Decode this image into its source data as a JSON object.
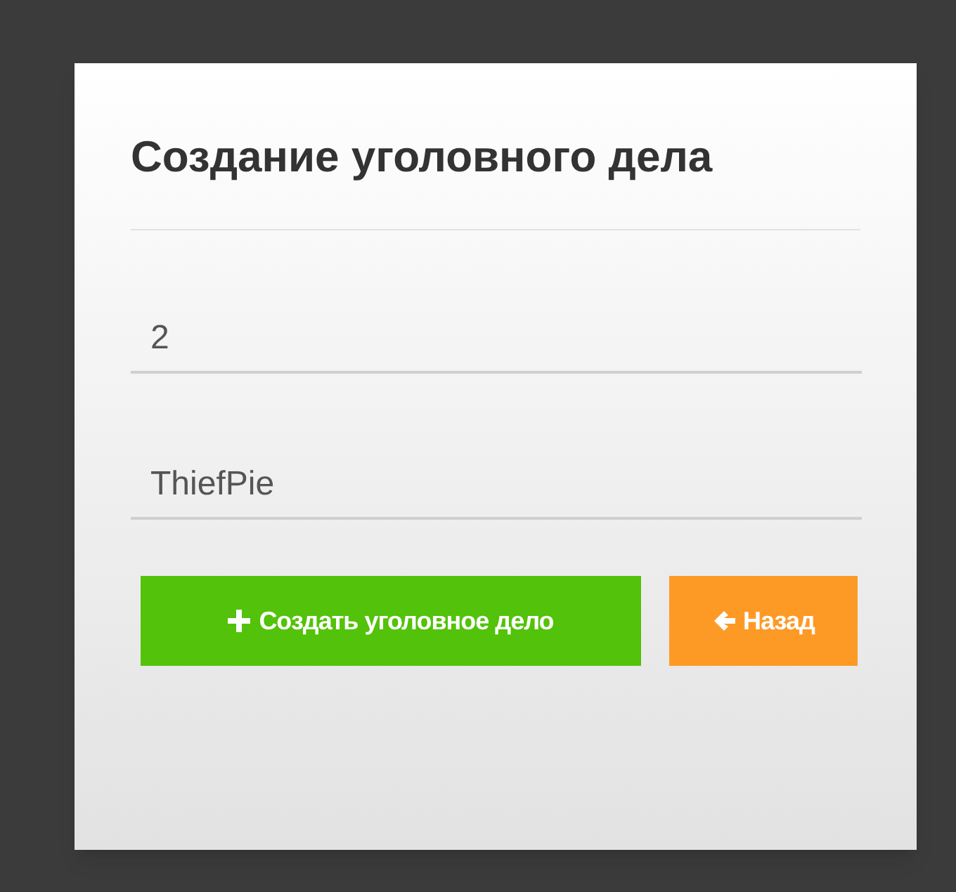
{
  "title": "Создание уголовного дела",
  "fields": [
    {
      "value": "2"
    },
    {
      "value": "ThiefPie"
    }
  ],
  "buttons": [
    {
      "label": "Создать уголовное дело",
      "kind": "create"
    },
    {
      "label": "Назад",
      "kind": "back"
    }
  ]
}
